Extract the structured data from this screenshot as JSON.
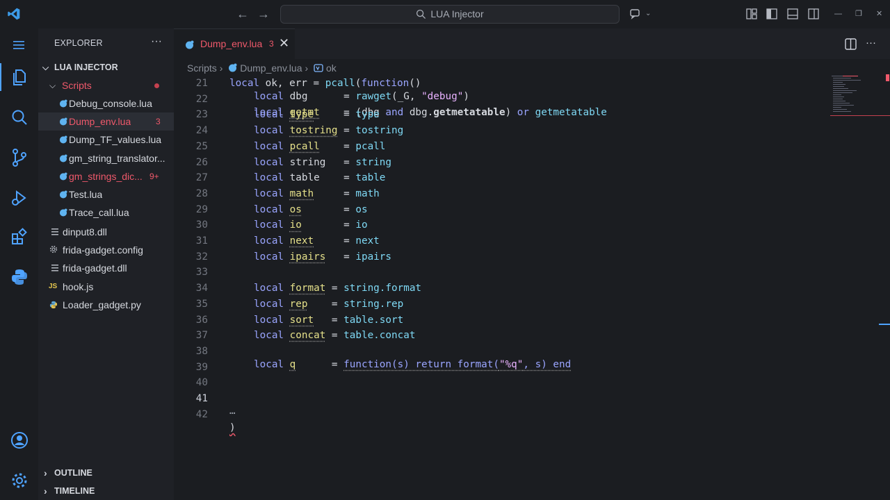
{
  "titlebar": {
    "search_label": "LUA Injector",
    "back_icon": "arrow-left-icon",
    "forward_icon": "arrow-right-icon"
  },
  "sidebar": {
    "title": "EXPLORER",
    "more": "···",
    "root_folder": "LUA INJECTOR",
    "scripts_folder": "Scripts",
    "files_in_scripts": [
      {
        "name": "Debug_console.lua",
        "badge": "",
        "state": "normal"
      },
      {
        "name": "Dump_env.lua",
        "badge": "3",
        "state": "error-selected"
      },
      {
        "name": "Dump_TF_values.lua",
        "badge": "",
        "state": "normal"
      },
      {
        "name": "gm_string_translator...",
        "badge": "",
        "state": "normal"
      },
      {
        "name": "gm_strings_dic...",
        "badge": "9+",
        "state": "error"
      },
      {
        "name": "Test.lua",
        "badge": "",
        "state": "normal"
      },
      {
        "name": "Trace_call.lua",
        "badge": "",
        "state": "normal"
      }
    ],
    "root_files": [
      {
        "name": "dinput8.dll",
        "icon": "list-file-icon"
      },
      {
        "name": "frida-gadget.config",
        "icon": "gear-file-icon"
      },
      {
        "name": "frida-gadget.dll",
        "icon": "list-file-icon"
      },
      {
        "name": "hook.js",
        "icon": "js-file-icon",
        "icon_text": "JS"
      },
      {
        "name": "Loader_gadget.py",
        "icon": "python-file-icon"
      }
    ],
    "outline": "OUTLINE",
    "timeline": "TIMELINE"
  },
  "editor": {
    "tab_label": "Dump_env.lua",
    "tab_badge": "3",
    "tab_close": "✕",
    "breadcrumbs": [
      "Scripts",
      "Dump_env.lua",
      "ok"
    ],
    "line_numbers": [
      "21",
      "22",
      "23",
      "24",
      "25",
      "26",
      "27",
      "28",
      "29",
      "30",
      "31",
      "32",
      "33",
      "34",
      "35",
      "36",
      "37",
      "38",
      "39",
      "40",
      "41",
      "42"
    ],
    "lines": {
      "l21": {
        "kw": "local",
        "rest1": " ok, err = ",
        "fn": "pcall",
        "rest2": "(",
        "kw2": "function",
        "rest3": "()"
      },
      "l21b": {
        "kw": "local",
        "name": "dbg",
        "pad": "      = ",
        "fn": "rawget",
        "rest": "(_G, ",
        "str": "\"debug\"",
        "end": ")"
      },
      "l22": {
        "kw": "local",
        "name": "getmt",
        "pad": "    = (dbg ",
        "kw2": "and",
        "mid": " dbg.",
        "bold": "getmetatable",
        "rp": ") ",
        "kw3": "or",
        "glob": " getmetatable"
      },
      "l23": {
        "kw": "local",
        "name": "type",
        "pad": "     = ",
        "glob": "type"
      },
      "l24": {
        "kw": "local",
        "name": "tostring",
        "pad": " = ",
        "glob": "tostring"
      },
      "l25": {
        "kw": "local",
        "name": "pcall",
        "pad": "    = ",
        "glob": "pcall"
      },
      "l26": {
        "kw": "local",
        "name": "string",
        "pad": "   = ",
        "glob": "string"
      },
      "l27": {
        "kw": "local",
        "name": "table",
        "pad": "    = ",
        "glob": "table"
      },
      "l28": {
        "kw": "local",
        "name": "math",
        "pad": "     = ",
        "glob": "math"
      },
      "l29": {
        "kw": "local",
        "name": "os",
        "pad": "       = ",
        "glob": "os"
      },
      "l30": {
        "kw": "local",
        "name": "io",
        "pad": "       = ",
        "glob": "io"
      },
      "l31": {
        "kw": "local",
        "name": "next",
        "pad": "     = ",
        "glob": "next"
      },
      "l32": {
        "kw": "local",
        "name": "ipairs",
        "pad": "   = ",
        "glob": "ipairs"
      },
      "l34": {
        "kw": "local",
        "name": "format",
        "pad": " = ",
        "glob": "string.format"
      },
      "l35": {
        "kw": "local",
        "name": "rep",
        "pad": "    = ",
        "glob": "string.rep"
      },
      "l36": {
        "kw": "local",
        "name": "sort",
        "pad": "   = ",
        "glob": "table.sort"
      },
      "l37": {
        "kw": "local",
        "name": "concat",
        "pad": " = ",
        "glob": "table.concat"
      },
      "l38": {
        "kw": "local",
        "name": "q",
        "pad": "      = ",
        "fn": "function(s) return format(",
        "str": "\"%q\"",
        "tail": ", s) end"
      },
      "l41": {
        "text": "…"
      },
      "l42": {
        "text": ")"
      }
    }
  },
  "colors": {
    "accent": "#4fa3ff",
    "error": "#f0596b",
    "keyword": "#9aa5ff",
    "local_name": "#e5e08a",
    "global": "#7fd9f5",
    "string": "#e9b2ff"
  }
}
